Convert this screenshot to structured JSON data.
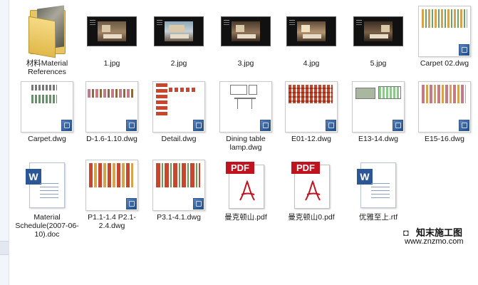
{
  "files": [
    {
      "name": "材料Material References",
      "type": "folder"
    },
    {
      "name": "1.jpg",
      "type": "jpg"
    },
    {
      "name": "2.jpg",
      "type": "jpg"
    },
    {
      "name": "3.jpg",
      "type": "jpg"
    },
    {
      "name": "4.jpg",
      "type": "jpg"
    },
    {
      "name": "5.jpg",
      "type": "jpg"
    },
    {
      "name": "Carpet 02.dwg",
      "type": "dwg"
    },
    {
      "name": "Carpet.dwg",
      "type": "dwg"
    },
    {
      "name": "D-1.6-1.10.dwg",
      "type": "dwg"
    },
    {
      "name": "Detail.dwg",
      "type": "dwg"
    },
    {
      "name": "Dining table lamp.dwg",
      "type": "dwg"
    },
    {
      "name": "E01-12.dwg",
      "type": "dwg"
    },
    {
      "name": "E13-14.dwg",
      "type": "dwg"
    },
    {
      "name": "E15-16.dwg",
      "type": "dwg"
    },
    {
      "name": "Material Schedule(2007-06-10).doc",
      "type": "doc"
    },
    {
      "name": "P1.1-1.4 P2.1-2.4.dwg",
      "type": "dwg"
    },
    {
      "name": "P3.1-4.1.dwg",
      "type": "dwg"
    },
    {
      "name": "曼克顿山.pdf",
      "type": "pdf"
    },
    {
      "name": "曼克顿山0.pdf",
      "type": "pdf"
    },
    {
      "name": "优雅至上.rtf",
      "type": "rtf"
    }
  ],
  "icons": {
    "folder": "folder-icon",
    "jpg": "image-thumbnail-icon",
    "dwg": "dwg-thumbnail-icon",
    "doc": "word-document-icon",
    "pdf": "pdf-icon",
    "rtf": "word-document-icon"
  },
  "pdf_label": "PDF",
  "word_letter": "W",
  "watermark": {
    "title": "知末施工图",
    "url": "www.znzmo.com"
  },
  "colors": {
    "pdf_red": "#c1121f",
    "word_blue": "#2b5797",
    "folder_yellow": "#e7c564"
  }
}
